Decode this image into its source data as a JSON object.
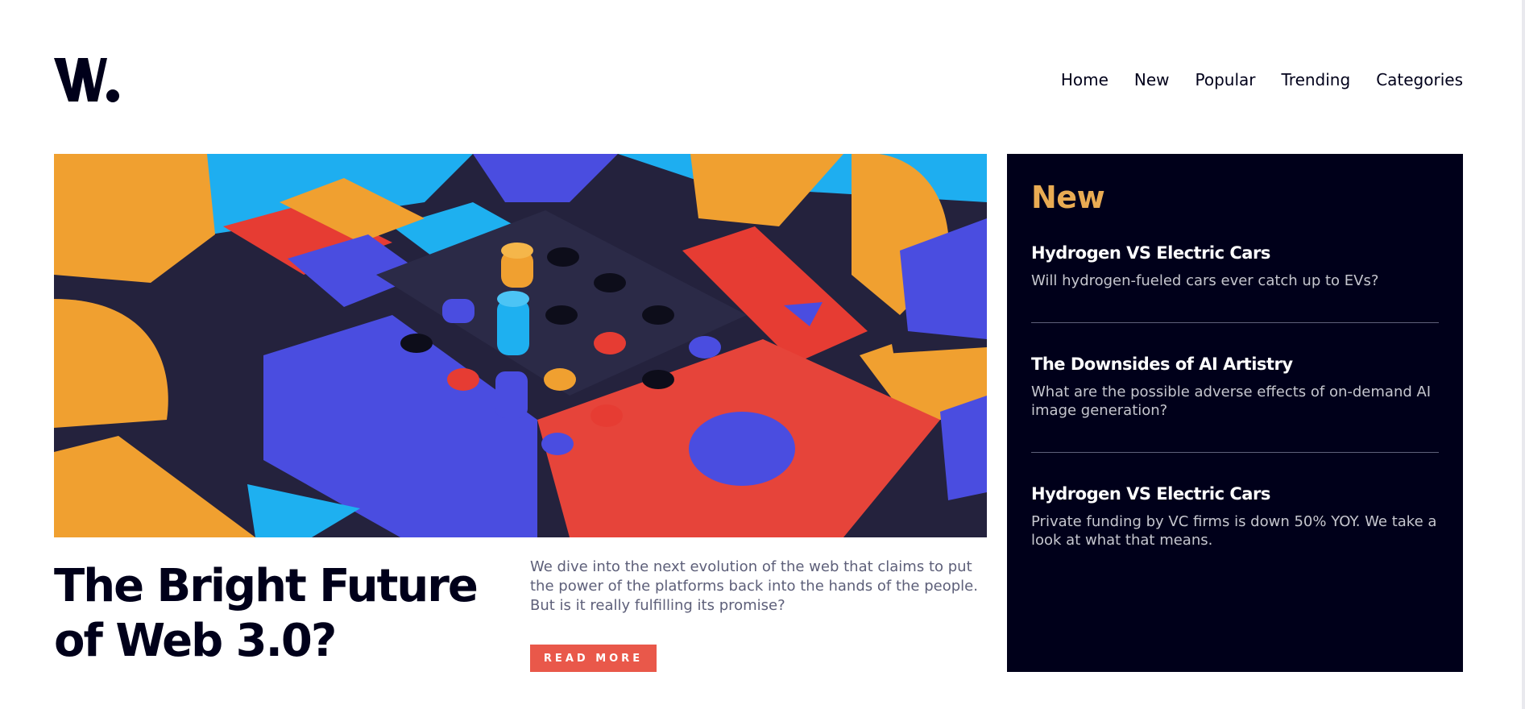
{
  "logo": {
    "alt": "W."
  },
  "nav": {
    "items": [
      "Home",
      "New",
      "Popular",
      "Trending",
      "Categories"
    ]
  },
  "hero": {
    "image_alt": "Colorful 3D block puzzle pieces",
    "headline": "The Bright Future of Web 3.0?",
    "summary": "We dive into the next evolution of the web that claims to put the power of the platforms back into the hands of the people. But is it really fulfilling its promise?",
    "read_more_label": "READ MORE"
  },
  "sidebar": {
    "title": "New",
    "items": [
      {
        "title": "Hydrogen VS Electric Cars",
        "description": "Will hydrogen-fueled cars ever catch up to EVs?"
      },
      {
        "title": "The Downsides of AI Artistry",
        "description": "What are the possible adverse effects of on-demand AI image generation?"
      },
      {
        "title": "Hydrogen VS Electric Cars",
        "description": "Private funding by VC firms is down 50% YOY. We take a look at what that means."
      }
    ]
  },
  "colors": {
    "accent_red": "#e9584a",
    "accent_orange": "#e9ab53",
    "dark_navy": "#00001a",
    "text_muted": "#5d5f79"
  }
}
